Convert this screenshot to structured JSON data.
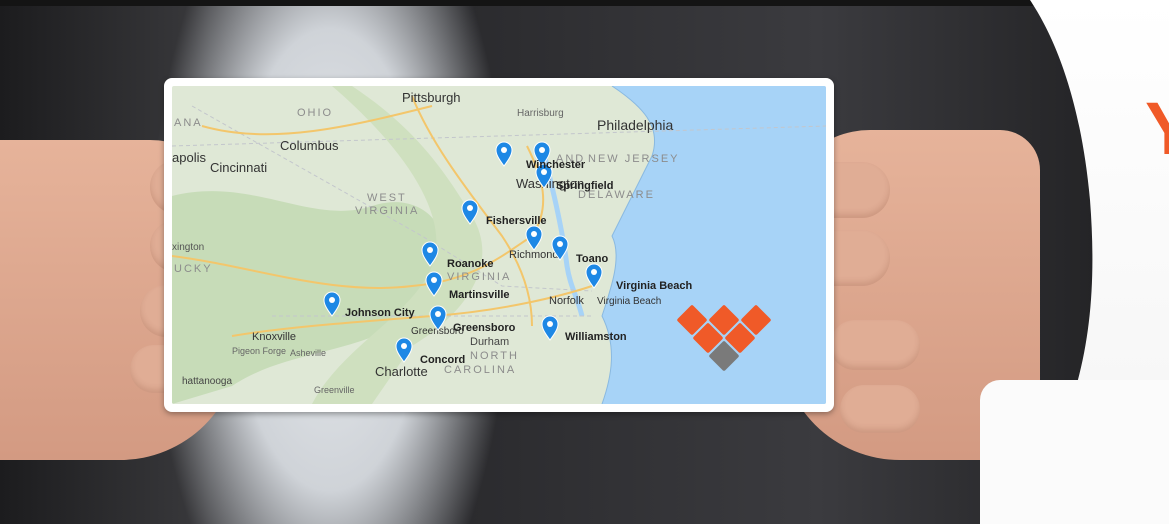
{
  "tagline": {
    "text": "Y",
    "color": "#f05a28"
  },
  "map": {
    "region_labels": [
      {
        "text": "OHIO"
      },
      {
        "text": "WEST"
      },
      {
        "text": "VIRGINIA"
      },
      {
        "text": "VIRGINIA"
      },
      {
        "text": "NORTH"
      },
      {
        "text": "CAROLINA"
      },
      {
        "text": "NEW JERSEY"
      },
      {
        "text": "DELAWARE"
      },
      {
        "text": "AND"
      },
      {
        "text": "ANA"
      },
      {
        "text": "UCKY"
      }
    ],
    "city_labels": [
      {
        "text": "Pittsburgh"
      },
      {
        "text": "Harrisburg"
      },
      {
        "text": "Philadelphia"
      },
      {
        "text": "Columbus"
      },
      {
        "text": "apolis"
      },
      {
        "text": "Cincinnati"
      },
      {
        "text": "xington"
      },
      {
        "text": "Richmond"
      },
      {
        "text": "Norfolk"
      },
      {
        "text": "Knoxville"
      },
      {
        "text": "Pigeon Forge"
      },
      {
        "text": "Asheville"
      },
      {
        "text": "hattanooga"
      },
      {
        "text": "Greenville"
      },
      {
        "text": "Durham"
      },
      {
        "text": "Charlotte"
      },
      {
        "text": "Greensboro"
      },
      {
        "text": "Washington"
      }
    ],
    "pins": [
      {
        "name": "Winchester"
      },
      {
        "name": "Washington"
      },
      {
        "name": "Springfield"
      },
      {
        "name": "Fishersville"
      },
      {
        "name": "Richmond"
      },
      {
        "name": "Toano"
      },
      {
        "name": "Roanoke"
      },
      {
        "name": "Martinsville"
      },
      {
        "name": "Virginia Beach"
      },
      {
        "name": "Johnson City"
      },
      {
        "name": "Greensboro"
      },
      {
        "name": "Williamston"
      },
      {
        "name": "Concord"
      }
    ],
    "pin_labels": [
      {
        "text": "Winchester"
      },
      {
        "text": "Springfield"
      },
      {
        "text": "Fishersville"
      },
      {
        "text": "Toano"
      },
      {
        "text": "Roanoke"
      },
      {
        "text": "Martinsville"
      },
      {
        "text": "Virginia Beach"
      },
      {
        "text": "Virginia Beach"
      },
      {
        "text": "Johnson City"
      },
      {
        "text": "Greensboro"
      },
      {
        "text": "Williamston"
      },
      {
        "text": "Concord"
      }
    ],
    "colors": {
      "land": "#dfe8d6",
      "forest": "#c7dcb8",
      "water": "#a7d3f7",
      "road": "#f3c66b",
      "pin": "#1e88e5"
    }
  },
  "logo": {
    "tiles": [
      {
        "color": "#f05a28"
      },
      {
        "color": "#f05a28"
      },
      {
        "color": "#f05a28"
      },
      {
        "color": "#f05a28"
      },
      {
        "color": "#f05a28"
      },
      {
        "color": "#7a7a7a"
      }
    ]
  }
}
